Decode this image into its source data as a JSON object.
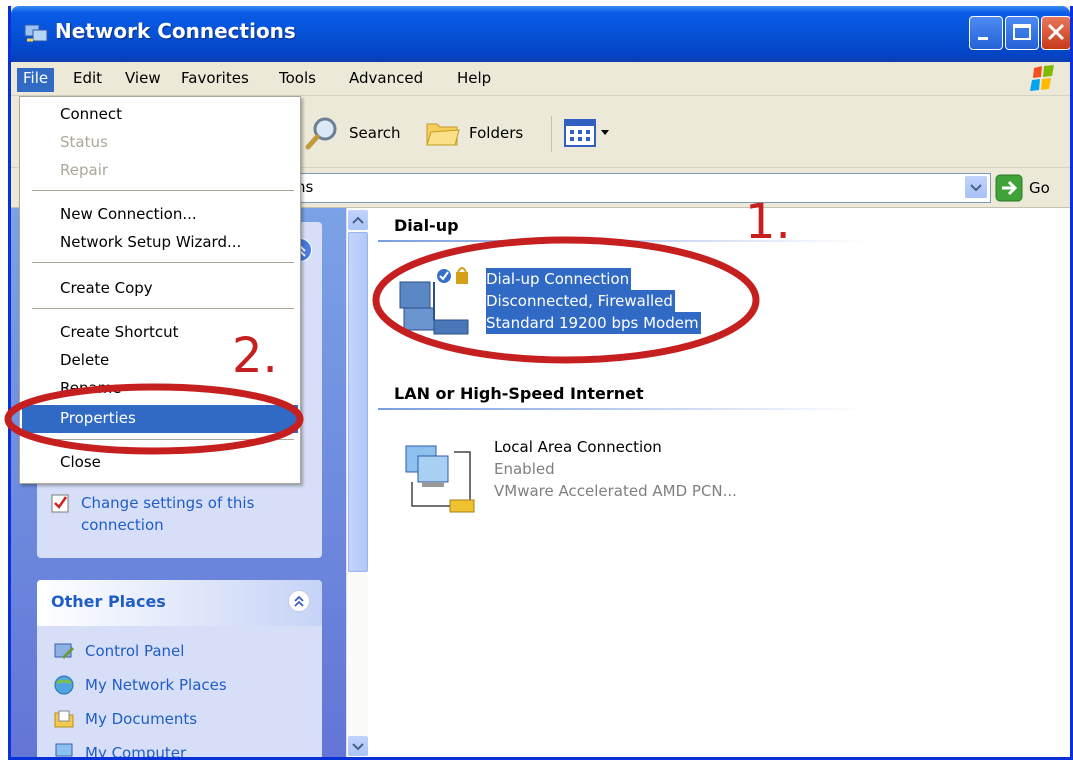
{
  "window": {
    "title": "Network Connections"
  },
  "menubar": {
    "items": [
      "File",
      "Edit",
      "View",
      "Favorites",
      "Tools",
      "Advanced",
      "Help"
    ],
    "active": "File"
  },
  "toolbar": {
    "search": "Search",
    "folders": "Folders"
  },
  "addressbar": {
    "value_fragment": "ns",
    "go": "Go"
  },
  "file_menu": {
    "items": [
      {
        "label": "Connect",
        "disabled": false
      },
      {
        "label": "Status",
        "disabled": true
      },
      {
        "label": "Repair",
        "disabled": true
      },
      {
        "label": "New Connection...",
        "disabled": false
      },
      {
        "label": "Network Setup Wizard...",
        "disabled": false
      },
      {
        "label": "Create Copy",
        "disabled": false
      },
      {
        "label": "Create Shortcut",
        "disabled": false
      },
      {
        "label": "Delete",
        "disabled": false
      },
      {
        "label": "Rename",
        "disabled": false
      },
      {
        "label": "Properties",
        "disabled": false,
        "highlighted": true
      },
      {
        "label": "Close",
        "disabled": false
      }
    ]
  },
  "tasks": {
    "change_settings": "Change settings of this connection"
  },
  "other_places": {
    "title": "Other Places",
    "items": [
      "Control Panel",
      "My Network Places",
      "My Documents",
      "My Computer"
    ]
  },
  "groups": {
    "dialup": {
      "title": "Dial-up",
      "connection": {
        "name": "Dial-up Connection",
        "status": "Disconnected, Firewalled",
        "device": "Standard 19200 bps Modem",
        "selected": true
      }
    },
    "lan": {
      "title": "LAN or High-Speed Internet",
      "connection": {
        "name": "Local Area Connection",
        "status": "Enabled",
        "device": "VMware Accelerated AMD PCN..."
      }
    }
  },
  "annotations": {
    "step1": "1.",
    "step2": "2."
  },
  "colors": {
    "accent": "#316ac5",
    "annotation": "#c61f1f",
    "titlebar": "#0552d7"
  },
  "icons": [
    "network-connections-icon",
    "windows-logo-icon",
    "search-icon",
    "folders-icon",
    "views-icon",
    "go-arrow-icon",
    "dialup-connection-icon",
    "lan-connection-icon",
    "checkbox-settings-icon",
    "control-panel-icon",
    "network-places-icon",
    "documents-icon",
    "computer-icon"
  ]
}
